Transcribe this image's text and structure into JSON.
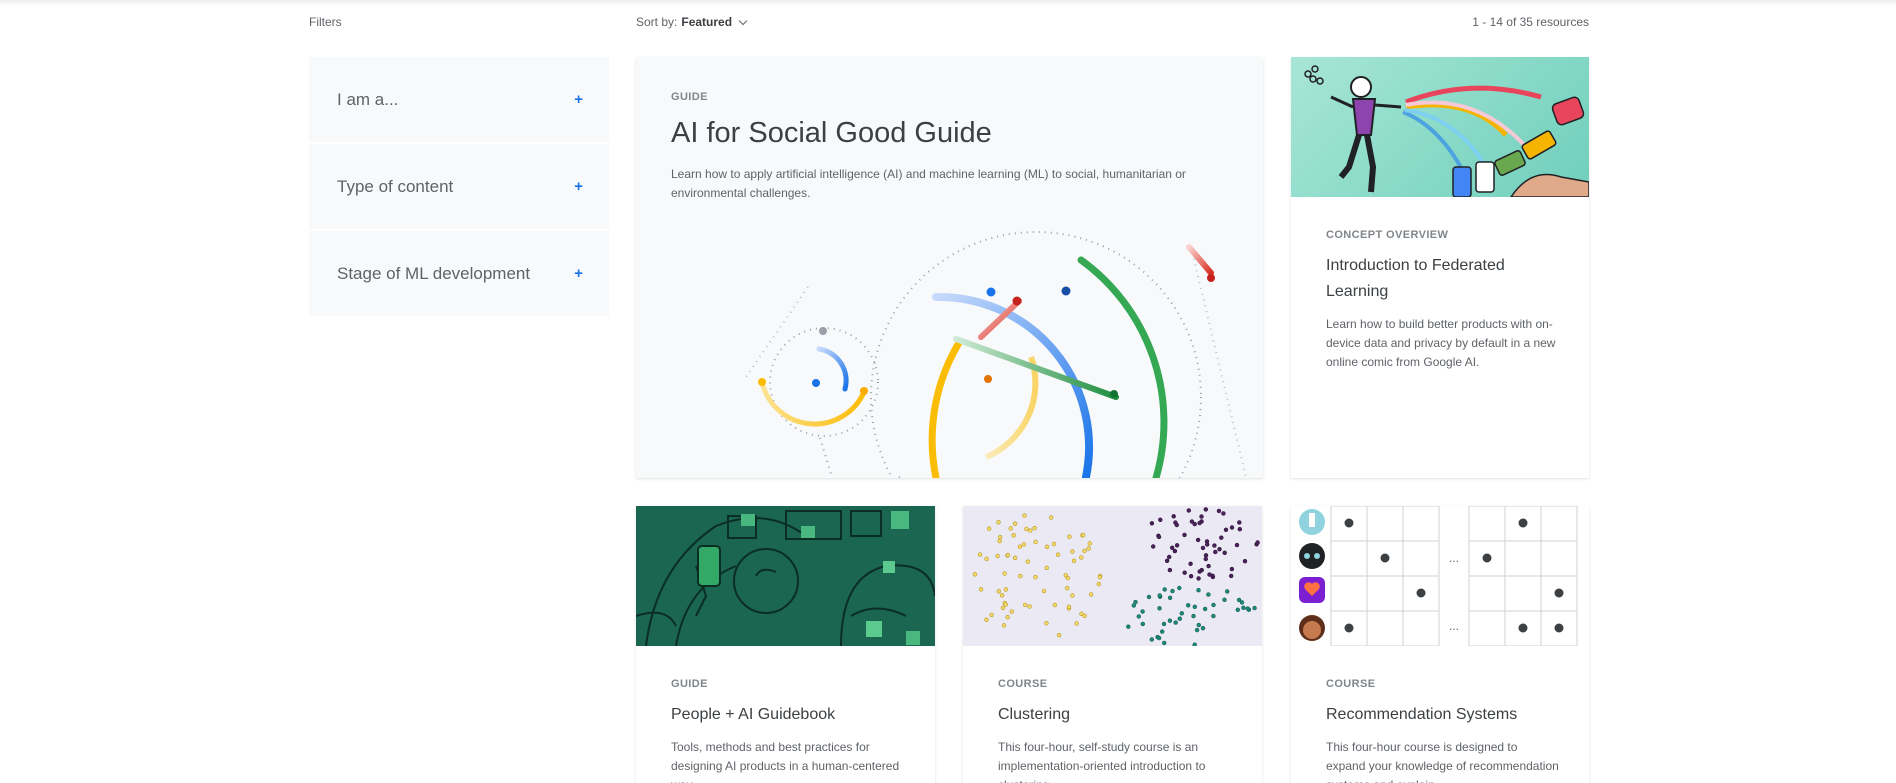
{
  "toolbar": {
    "filters_label": "Filters",
    "sort_prefix": "Sort by:",
    "sort_value": "Featured",
    "results_count": "1 - 14 of 35 resources"
  },
  "filters": [
    {
      "label": "I am a...",
      "toggle": "+"
    },
    {
      "label": "Type of content",
      "toggle": "+"
    },
    {
      "label": "Stage of ML development",
      "toggle": "+"
    }
  ],
  "featured": {
    "eyebrow": "GUIDE",
    "title": "AI for Social Good Guide",
    "description": "Learn how to apply artificial intelligence (AI) and machine learning (ML) to social, humanitarian or environmental challenges."
  },
  "cards": [
    {
      "eyebrow": "CONCEPT OVERVIEW",
      "title": "Introduction to Federated Learning",
      "description": "Learn how to build better products with on-device data and privacy by default in a new online comic from Google AI."
    },
    {
      "eyebrow": "GUIDE",
      "title": "People + AI Guidebook",
      "description": "Tools, methods and best practices for designing AI products in a human-centered way."
    },
    {
      "eyebrow": "COURSE",
      "title": "Clustering",
      "description": "This four-hour, self-study course is an implementation-oriented introduction to clustering."
    },
    {
      "eyebrow": "COURSE",
      "title": "Recommendation Systems",
      "description": "This four-hour course is designed to expand your knowledge of recommendation systems and explain"
    }
  ],
  "recsys_matrix": {
    "ellipsis": "..."
  },
  "colors": {
    "accent_blue": "#1a73e8",
    "google_green": "#34a853",
    "google_yellow": "#fbbc04",
    "google_red": "#ea4335",
    "panel_bg": "#f8f9fa"
  }
}
